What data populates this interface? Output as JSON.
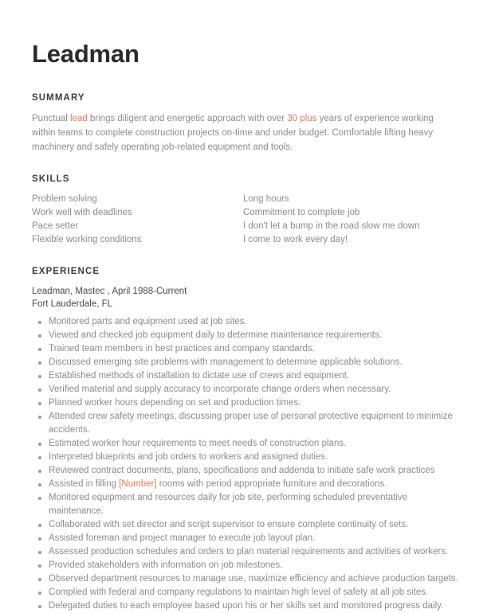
{
  "document": {
    "title": "Leadman",
    "accent_color": "#e8765c",
    "text_color": "#8b8b8b",
    "heading_color": "#3d3d3d"
  },
  "summary": {
    "heading": "SUMMARY",
    "parts": [
      {
        "text": "Punctual ",
        "highlight": false
      },
      {
        "text": "lead",
        "highlight": true
      },
      {
        "text": " brings diligent and energetic approach with over ",
        "highlight": false
      },
      {
        "text": "30 plus",
        "highlight": true
      },
      {
        "text": " years of experience working within teams to complete construction projects on-time and under budget. Comfortable lifting heavy machinery and safely operating job-related equipment and tools.",
        "highlight": false
      }
    ]
  },
  "skills": {
    "heading": "SKILLS",
    "left_column": [
      "Problem solving",
      "Work well with deadlines",
      "Pace setter",
      "Flexible working conditions"
    ],
    "right_column": [
      "Long hours",
      "Commitment to complete job",
      "I don't let a bump in the road slow me down",
      "I come to work every day!"
    ]
  },
  "experience": {
    "heading": "EXPERIENCE",
    "jobs": [
      {
        "title_line": "Leadman, Mastec , April 1988-Current",
        "location": "Fort Lauderdale, FL",
        "bullets": [
          [
            {
              "text": "Monitored parts and equipment used at job sites.",
              "highlight": false
            }
          ],
          [
            {
              "text": "Viewed and checked job equipment daily to determine maintenance requirements.",
              "highlight": false
            }
          ],
          [
            {
              "text": "Trained team members in best practices and company standards.",
              "highlight": false
            }
          ],
          [
            {
              "text": "Discussed emerging site problems with management to determine applicable solutions.",
              "highlight": false
            }
          ],
          [
            {
              "text": "Established methods of installation to dictate use of crews and equipment.",
              "highlight": false
            }
          ],
          [
            {
              "text": "Verified material and supply accuracy to incorporate change orders when necessary.",
              "highlight": false
            }
          ],
          [
            {
              "text": "Planned worker hours depending on set and production times.",
              "highlight": false
            }
          ],
          [
            {
              "text": "Attended crew safety meetings, discussing proper use of personal protective equipment to minimize accidents.",
              "highlight": false
            }
          ],
          [
            {
              "text": "Estimated worker hour requirements to meet needs of construction plans.",
              "highlight": false
            }
          ],
          [
            {
              "text": "Interpreted blueprints and job orders to workers and assigned duties.",
              "highlight": false
            }
          ],
          [
            {
              "text": "Reviewed contract documents, plans, specifications and addenda to initiate safe work practices",
              "highlight": false
            }
          ],
          [
            {
              "text": "Assisted in filling ",
              "highlight": false
            },
            {
              "text": "[Number]",
              "highlight": true
            },
            {
              "text": " rooms with period appropriate furniture and decorations.",
              "highlight": false
            }
          ],
          [
            {
              "text": "Monitored equipment and resources daily for job site, performing scheduled preventative maintenance.",
              "highlight": false
            }
          ],
          [
            {
              "text": "Collaborated with set director and script supervisor to ensure complete continuity of sets.",
              "highlight": false
            }
          ],
          [
            {
              "text": "Assisted foreman and project manager to execute job layout plan.",
              "highlight": false
            }
          ],
          [
            {
              "text": "Assessed production schedules and orders to plan material requirements and activities of workers.",
              "highlight": false
            }
          ],
          [
            {
              "text": "Provided stakeholders with information on job milestones.",
              "highlight": false
            }
          ],
          [
            {
              "text": "Observed department resources to manage use, maximize efficiency and achieve production targets.",
              "highlight": false
            }
          ],
          [
            {
              "text": "Complied with federal and company regulations to maintain high level of safety at all job sites.",
              "highlight": false
            }
          ],
          [
            {
              "text": "Delegated duties to each employee based upon his or her skills set and monitored progress daily.",
              "highlight": false
            }
          ]
        ]
      }
    ]
  }
}
